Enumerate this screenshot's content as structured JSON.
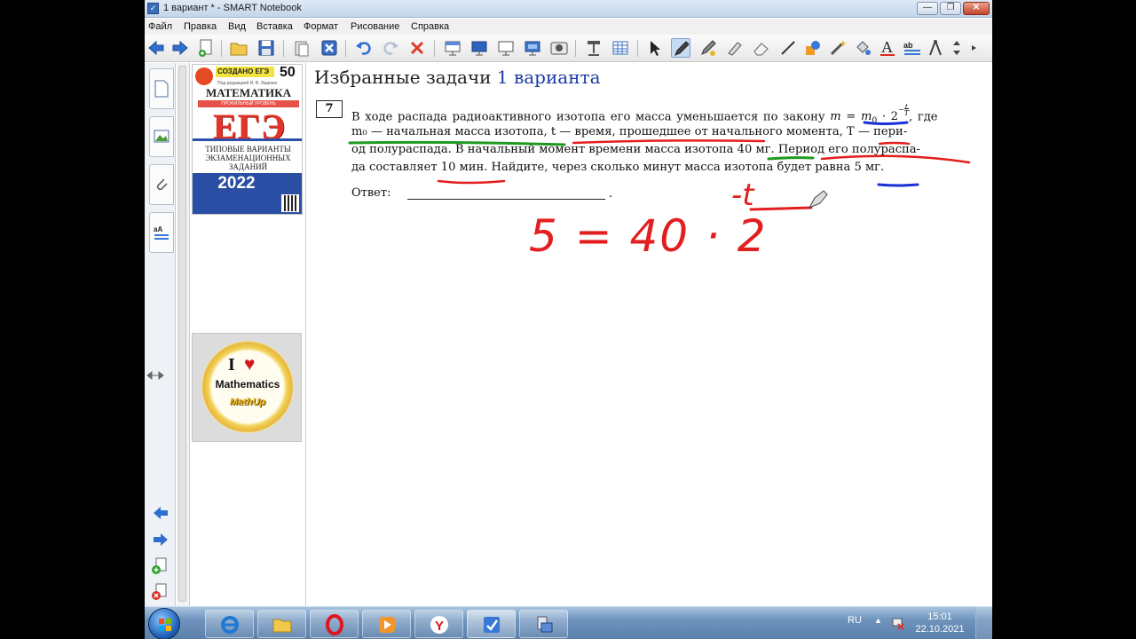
{
  "window": {
    "title": "1 вариант * - SMART Notebook"
  },
  "menu": [
    "Файл",
    "Правка",
    "Вид",
    "Вставка",
    "Формат",
    "Рисование",
    "Справка"
  ],
  "book_cover": {
    "created": "СОЗДАНО ЕГЭ",
    "count": "50",
    "editor": "Под редакцией И. В. Ященко",
    "subject": "МАТЕМАТИКА",
    "level": "ПРОФИЛЬНЫЙ УРОВЕНЬ",
    "exam": "ЕГЭ",
    "types_line1": "ТИПОВЫЕ ВАРИАНТЫ",
    "types_line2": "ЭКЗАМЕНАЦИОННЫХ",
    "types_line3": "ЗАДАНИЙ",
    "year": "2022"
  },
  "math_logo": {
    "i": "I",
    "word": "Mathematics",
    "brand": "MathUp"
  },
  "page": {
    "heading": "Избранные задачи",
    "heading_hl": "1 варианта",
    "task_number": "7",
    "line1": "В ходе распада радиоактивного изотопа его масса уменьшается по закону",
    "line1_end": ", где",
    "line2": "m₀ — начальная масса изотопа, t — время, прошедшее от начального момента, T — пери-",
    "line3": "од полураспада. В начальный момент времени масса изотопа 40 мг. Период его полураспа-",
    "line4": "да составляет 10 мин. Найдите, через сколько минут масса изотопа будет равна 5 мг.",
    "answer_label": "Ответ:",
    "answer_end": "."
  },
  "handwriting": {
    "equation": "5 = 40 · 2",
    "exponent": "-t",
    "color": "#e31e1e"
  },
  "taskbar": {
    "lang": "RU",
    "time": "15:01",
    "date": "22.10.2021"
  },
  "colors": {
    "ink_red": "#e31e1e",
    "ink_green": "#1f9a1f",
    "ink_blue": "#1a2fd6",
    "heading_blue": "#1b3aa5"
  }
}
